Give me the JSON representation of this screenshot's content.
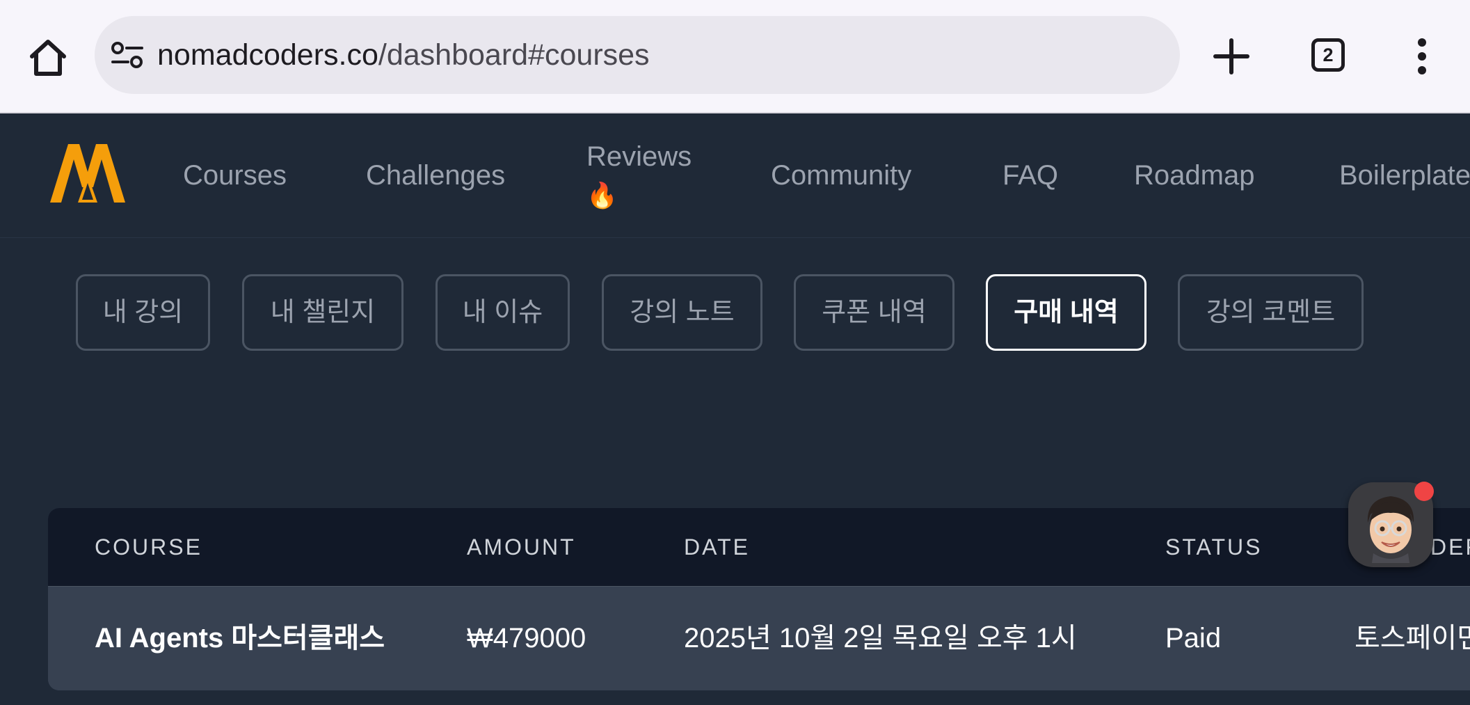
{
  "browser": {
    "url_domain": "nomadcoders.co",
    "url_path": "/dashboard#courses",
    "tab_count": "2",
    "icons": [
      "home-icon",
      "site-settings-icon",
      "new-tab-plus-icon",
      "tab-switcher-icon",
      "more-vert-icon"
    ]
  },
  "nav": {
    "logo": "nomad-coders-logo",
    "links": [
      "Courses",
      "Challenges",
      "Reviews",
      "Community",
      "FAQ",
      "Roadmap",
      "Boilerplate"
    ],
    "reviews_emoji": "🔥"
  },
  "dashboard": {
    "tabs": [
      "내 강의",
      "내 챌린지",
      "내 이슈",
      "강의 노트",
      "쿠폰 내역",
      "구매 내역",
      "강의 코멘트"
    ],
    "active_tab": "구매 내역"
  },
  "table": {
    "headers": [
      "COURSE",
      "AMOUNT",
      "DATE",
      "STATUS",
      "DER"
    ],
    "rows": [
      {
        "course": "AI Agents 마스터클래스",
        "amount": "₩479000",
        "date": "2025년 10월 2일 목요일 오후 1시",
        "status": "Paid",
        "provider": "토스페이먼"
      }
    ]
  },
  "colors": {
    "page_bg": "#1f2937",
    "table_head_bg": "#111827",
    "table_row_bg": "#374151",
    "brand_orange": "#f59e0b",
    "notification_dot": "#ef4444"
  }
}
